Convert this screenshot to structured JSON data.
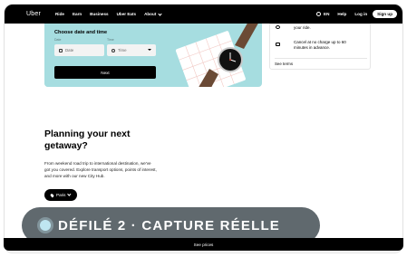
{
  "nav": {
    "logo": "Uber",
    "links": [
      "Ride",
      "Earn",
      "Business",
      "Uber Eats",
      "About"
    ],
    "language": "EN",
    "help": "Help",
    "login": "Log in",
    "signup": "Sign up"
  },
  "schedule": {
    "title": "Choose date and time",
    "date_label": "Date",
    "date_placeholder": "Date",
    "time_label": "Time",
    "time_placeholder": "Time",
    "next_button": "Next"
  },
  "benefits": {
    "item_1": "your ride.",
    "item_2_line1": "Cancel at no charge up to 60",
    "item_2_line2": "minutes in advance.",
    "see_terms": "See terms"
  },
  "planning": {
    "title_line1": "Planning your next",
    "title_line2": "getaway?",
    "desc_line1": "From weekend road trip to international destination, we've",
    "desc_line2": "got you covered. Explore transport options, points of interest,",
    "desc_line3": "and more with our new City Hub.",
    "city_button": "Paris"
  },
  "overlay": {
    "text": "DÉFILÉ 2 · CAPTURE RÉELLE"
  },
  "bottom_bar": {
    "label": "See prices"
  },
  "colors": {
    "hero_bg": "#a6dde0",
    "nav_bg": "#000000",
    "overlay_bg": "#465056",
    "overlay_dot": "#bfe6f1"
  }
}
